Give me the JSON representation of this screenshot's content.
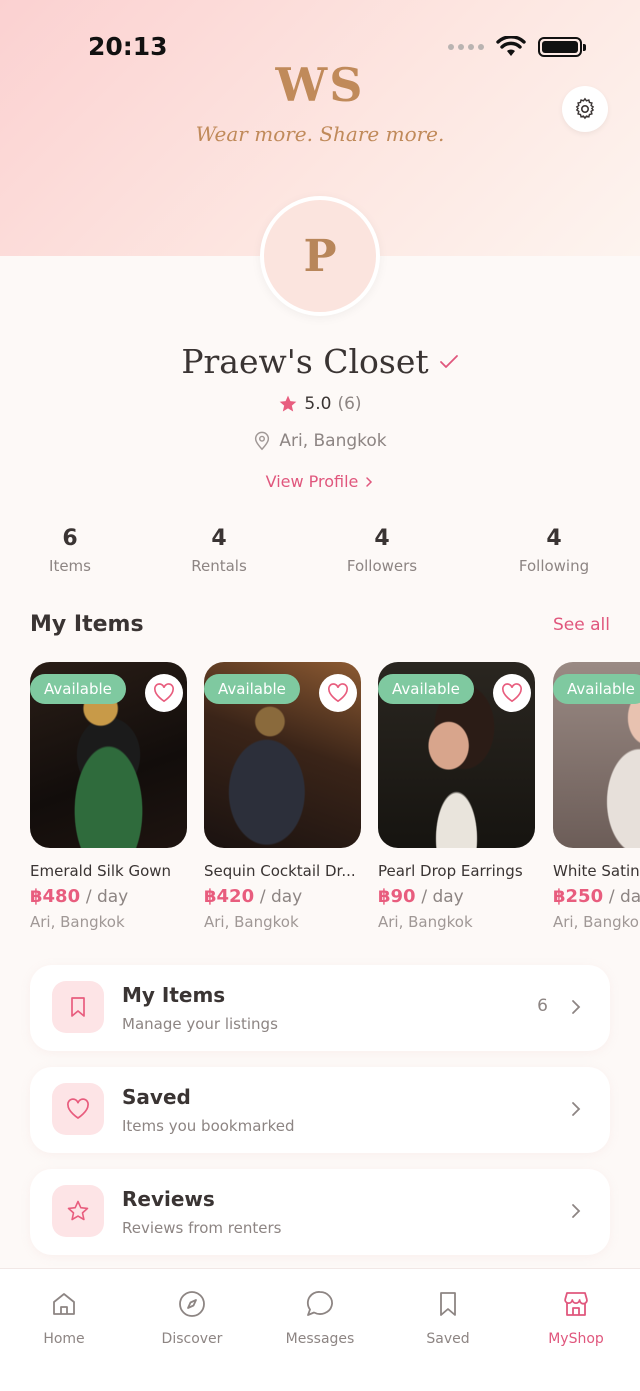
{
  "status_bar": {
    "time": "20:13"
  },
  "brand": {
    "logo": "WS",
    "tagline": "Wear more. Share more."
  },
  "profile": {
    "avatar_letter": "P",
    "shop_name": "Praew's Closet",
    "rating": "5.0",
    "rating_count": "(6)",
    "location": "Ari, Bangkok",
    "view_profile_label": "View Profile"
  },
  "stats": [
    {
      "value": "6",
      "label": "Items"
    },
    {
      "value": "4",
      "label": "Rentals"
    },
    {
      "value": "4",
      "label": "Followers"
    },
    {
      "value": "4",
      "label": "Following"
    }
  ],
  "my_items": {
    "title": "My Items",
    "see_all_label": "See all",
    "items": [
      {
        "badge": "Available",
        "name": "Emerald Silk Gown",
        "price": "฿480",
        "unit": "/ day",
        "location": "Ari, Bangkok"
      },
      {
        "badge": "Available",
        "name": "Sequin Cocktail Dr...",
        "price": "฿420",
        "unit": "/ day",
        "location": "Ari, Bangkok"
      },
      {
        "badge": "Available",
        "name": "Pearl Drop Earrings",
        "price": "฿90",
        "unit": "/ day",
        "location": "Ari, Bangkok"
      },
      {
        "badge": "Available",
        "name": "White Satin",
        "price": "฿250",
        "unit": "/ da",
        "location": "Ari, Bangkok"
      }
    ]
  },
  "menu": [
    {
      "title": "My Items",
      "subtitle": "Manage your listings",
      "count": "6",
      "icon": "bookmark-icon"
    },
    {
      "title": "Saved",
      "subtitle": "Items you bookmarked",
      "icon": "heart-icon"
    },
    {
      "title": "Reviews",
      "subtitle": "Reviews from renters",
      "icon": "star-icon"
    }
  ],
  "tabbar": [
    {
      "label": "Home",
      "icon": "home-icon"
    },
    {
      "label": "Discover",
      "icon": "compass-icon"
    },
    {
      "label": "Messages",
      "icon": "chat-icon"
    },
    {
      "label": "Saved",
      "icon": "bookmark-icon"
    },
    {
      "label": "MyShop",
      "icon": "shop-icon",
      "active": true
    }
  ],
  "colors": {
    "accent": "#e0577d",
    "badge": "#7fc9a0",
    "brand": "#c08a5a"
  }
}
